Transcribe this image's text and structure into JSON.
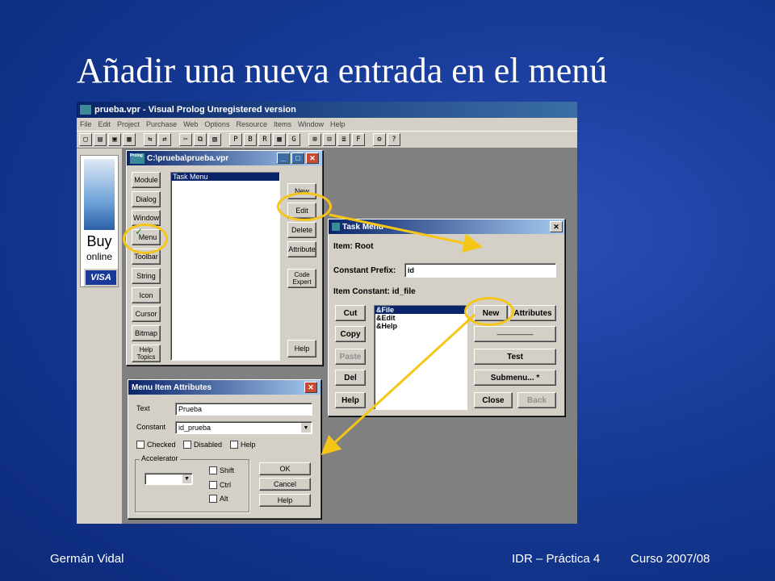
{
  "slide": {
    "title": "Añadir una nueva entrada en el menú",
    "footer_author": "Germán Vidal",
    "footer_course": "IDR – Práctica 4",
    "footer_year": "Curso 2007/08"
  },
  "app": {
    "title": "prueba.vpr - Visual Prolog Unregistered version",
    "menu": [
      "File",
      "Edit",
      "Project",
      "Purchase",
      "Web",
      "Options",
      "Resource",
      "Items",
      "Window",
      "Help"
    ],
    "toolbar_letters": [
      "P",
      "B",
      "R",
      "G",
      "F"
    ],
    "ad": {
      "buy": "Buy",
      "online": "online",
      "card": "VISA"
    }
  },
  "project_window": {
    "title": "C:\\prueba\\prueba.vpr",
    "icon_label": "Prolog",
    "left_buttons": [
      "Module",
      "Dialog",
      "Window",
      "Menu",
      "Toolbar",
      "String",
      "Icon",
      "Cursor",
      "Bitmap",
      "Help Topics"
    ],
    "list_items": [
      "Task Menu"
    ],
    "right_buttons": [
      "New",
      "Edit",
      "Delete",
      "Attribute",
      "Code Expert",
      "Help"
    ]
  },
  "task_menu": {
    "title": "Task Menu",
    "item_label": "Item: Root",
    "prefix_label": "Constant Prefix:",
    "prefix_value": "id",
    "constant_label": "Item Constant: id_file",
    "items": [
      "&File",
      "&Edit",
      "&Help"
    ],
    "left_buttons": [
      "Cut",
      "Copy",
      "Paste",
      "Del",
      "Help"
    ],
    "new_button": "New",
    "attributes_button": "Attributes",
    "separator_button": "—————",
    "test_button": "Test",
    "submenu_button": "Submenu... *",
    "close_button": "Close",
    "back_button": "Back"
  },
  "menu_attrs": {
    "title": "Menu Item Attributes",
    "text_label": "Text",
    "text_value": "Prueba",
    "constant_label": "Constant",
    "constant_value": "id_prueba",
    "checks": [
      "Checked",
      "Disabled",
      "Help"
    ],
    "accelerator_label": "Accelerator",
    "modifiers": [
      "Shift",
      "Ctrl",
      "Alt"
    ],
    "ok": "OK",
    "cancel": "Cancel",
    "help": "Help"
  },
  "colors": {
    "highlight": "#f5c518",
    "slide_bg": "#163a96"
  }
}
